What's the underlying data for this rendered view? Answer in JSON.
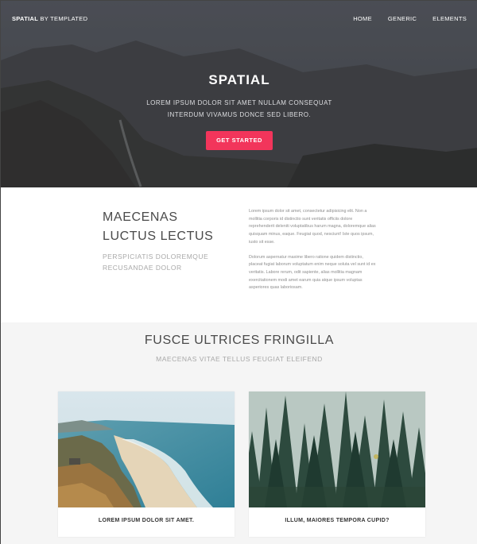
{
  "nav": {
    "brand_bold": "SPATIAL",
    "brand_rest": " BY TEMPLATED",
    "links": [
      "HOME",
      "GENERIC",
      "ELEMENTS"
    ]
  },
  "hero": {
    "title": "SPATIAL",
    "subtitle": "LOREM IPSUM DOLOR SIT AMET NULLAM CONSEQUAT INTERDUM VIVAMUS DONCE SED LIBERO.",
    "cta": "GET STARTED",
    "accent": "#f2355b"
  },
  "intro": {
    "heading_line1": "MAECENAS",
    "heading_line2": "LUCTUS LECTUS",
    "tagline": "PERSPICIATIS DOLOREMQUE RECUSANDAE DOLOR",
    "para1": "Lorem ipsum dolor sit amet, consectetur adipisicing elit. Non a mollitia corporis id distinctio sunt veritatis officiis dolore reprehenderit deleniti voluptatibus harum magna, doloremque alias quisquam minus, eaque. Feugiat quod, nesciunt! Iste quos ipsum, iusto sit esse.",
    "para2": "Dolorum aspernatur maxime libero ratione quidem distinctio, placeat fugiat laborum voluptatum enim neque soluta vel sunt id ex veritatis. Labore rerum, odit sapiente, alias mollitia magnam exercitationem modi amet earum quia atque ipsum voluptas asperiores quas laboriosam."
  },
  "features": {
    "title": "FUSCE ULTRICES FRINGILLA",
    "subtitle": "MAECENAS VITAE TELLUS FEUGIAT ELEIFEND",
    "cards": [
      {
        "label": "LOREM IPSUM DOLOR SIT AMET.",
        "image": "coastline-photo"
      },
      {
        "label": "ILLUM, MAIORES TEMPORA CUPID?",
        "image": "forest-photo"
      }
    ]
  }
}
